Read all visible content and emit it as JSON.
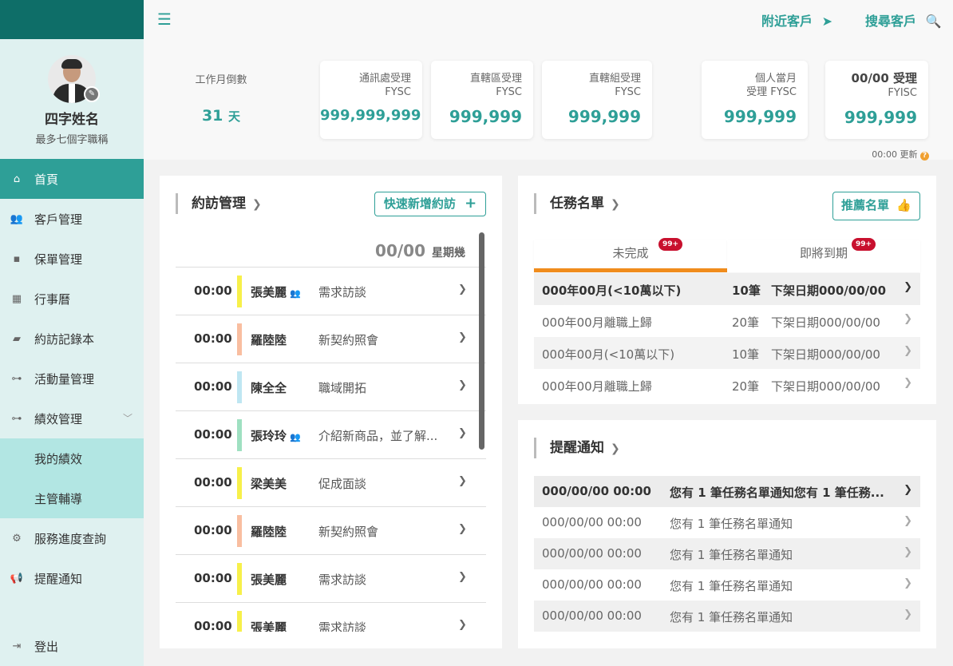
{
  "sidebar": {
    "profile": {
      "name": "四字姓名",
      "title": "最多七個字職稱"
    },
    "menu": {
      "home": "首頁",
      "customers": "客戶管理",
      "policies": "保單管理",
      "calendar": "行事曆",
      "visit_log": "約訪記錄本",
      "activity": "活動量管理",
      "performance": "績效管理",
      "my_performance": "我的績效",
      "supervisor": "主管輔導",
      "service_query": "服務進度查詢",
      "reminders": "提醒通知",
      "logout": "登出"
    },
    "active_item": "首頁"
  },
  "topbar": {
    "nearby": "附近客戶",
    "search": "搜尋客戶"
  },
  "stats": {
    "countdown": {
      "label": "工作月倒數",
      "value": "31",
      "unit": "天"
    },
    "cards": [
      {
        "label1": "通訊處受理",
        "label2": "FYSC",
        "value": "999,999,999"
      },
      {
        "label1": "直轄區受理",
        "label2": "FYSC",
        "value": "999,999"
      },
      {
        "label1": "直轄組受理",
        "label2": "FYSC",
        "value": "999,999"
      },
      {
        "label1": "個人當月",
        "label2": "受理 FYSC",
        "value": "999,999"
      },
      {
        "label1": "00/00 受理",
        "label2": "FYISC",
        "value": "999,999"
      }
    ],
    "updated": "00:00 更新",
    "help_icon": "question-icon"
  },
  "appointments": {
    "title": "約訪管理",
    "quick_add": "快速新增約訪",
    "date": "00/00",
    "weekday": "星期幾",
    "items": [
      {
        "time": "00:00",
        "name": "張美麗",
        "group": true,
        "desc": "需求訪談",
        "color": "#f7f04a"
      },
      {
        "time": "00:00",
        "name": "羅陸陸",
        "group": false,
        "desc": "新契約照會",
        "color": "#f9bea0"
      },
      {
        "time": "00:00",
        "name": "陳全全",
        "group": false,
        "desc": "職域開拓",
        "color": "#bfe6f2"
      },
      {
        "time": "00:00",
        "name": "張玲玲",
        "group": true,
        "desc": "介紹新商品，並了解...",
        "color": "#9fe0c1"
      },
      {
        "time": "00:00",
        "name": "梁美美",
        "group": false,
        "desc": "促成面談",
        "color": "#f7f04a"
      },
      {
        "time": "00:00",
        "name": "羅陸陸",
        "group": false,
        "desc": "新契約照會",
        "color": "#f9bea0"
      },
      {
        "time": "00:00",
        "name": "張美麗",
        "group": false,
        "desc": "需求訪談",
        "color": "#f7f04a"
      },
      {
        "time": "00:00",
        "name": "張美麗",
        "group": false,
        "desc": "需求訪談",
        "color": "#f7f04a"
      }
    ]
  },
  "tasks": {
    "title": "任務名單",
    "recommend": "推薦名單",
    "tabs": [
      {
        "label": "未完成",
        "badge": "99+"
      },
      {
        "label": "即將到期",
        "badge": "99+"
      }
    ],
    "rows": [
      {
        "c1": "000年00月(<10萬以下)",
        "c2": "10筆",
        "c3": "下架日期000/00/00"
      },
      {
        "c1": "000年00月離職上歸",
        "c2": "20筆",
        "c3": "下架日期000/00/00"
      },
      {
        "c1": "000年00月(<10萬以下)",
        "c2": "10筆",
        "c3": "下架日期000/00/00"
      },
      {
        "c1": "000年00月離職上歸",
        "c2": "20筆",
        "c3": "下架日期000/00/00"
      }
    ]
  },
  "notifications": {
    "title": "提醒通知",
    "rows": [
      {
        "date": "000/00/00 00:00",
        "msg": "您有 1 筆任務名單通知您有 1 筆任務..."
      },
      {
        "date": "000/00/00 00:00",
        "msg": "您有 1 筆任務名單通知"
      },
      {
        "date": "000/00/00 00:00",
        "msg": "您有 1 筆任務名單通知"
      },
      {
        "date": "000/00/00 00:00",
        "msg": "您有 1 筆任務名單通知"
      },
      {
        "date": "000/00/00 00:00",
        "msg": "您有 1 筆任務名單通知"
      }
    ]
  },
  "colors": {
    "brand": "#2e9f97",
    "brand_dark": "#0e6e68",
    "badge": "#c8102e",
    "tab_active": "#f08c1c"
  }
}
